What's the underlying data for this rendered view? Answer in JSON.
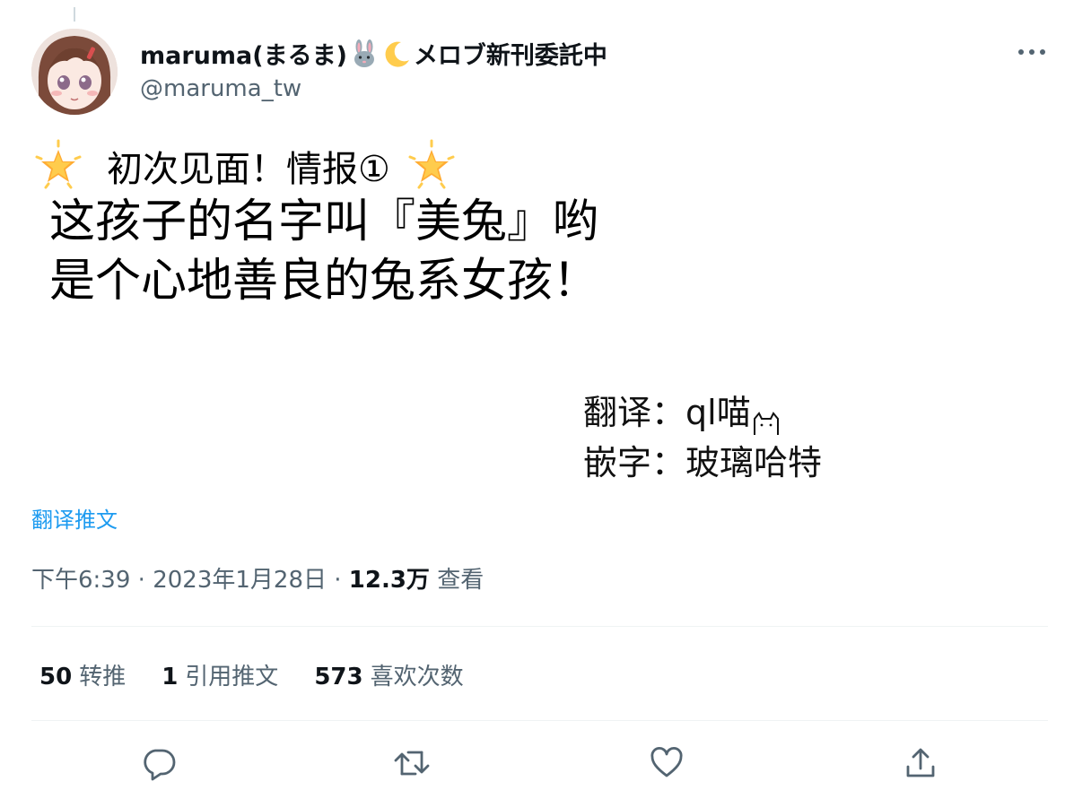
{
  "author": {
    "display_name": "maruma(まるま)",
    "display_name_suffix": "メロブ新刊委託中",
    "handle": "@maruma_tw",
    "name_icons": [
      "rabbit-icon",
      "crescent-moon-icon"
    ]
  },
  "tweet": {
    "line1": "初次见面！情报①",
    "line2": "这孩子的名字叫『美兔』哟",
    "line3": "是个心地善良的兔系女孩！",
    "credits": {
      "translate_label": "翻译：",
      "translate_name": "ql喵",
      "typeset_label": "嵌字：",
      "typeset_name": "玻璃哈特"
    }
  },
  "translate_link": "翻译推文",
  "meta": {
    "time": "下午6:39",
    "separator": "·",
    "date": "2023年1月28日",
    "views_count": "12.3万",
    "views_label": "查看"
  },
  "stats": {
    "retweets_count": "50",
    "retweets_label": "转推",
    "quotes_count": "1",
    "quotes_label": "引用推文",
    "likes_count": "573",
    "likes_label": "喜欢次数"
  },
  "icons": {
    "star": "glowing-star-icon",
    "more": "more-icon",
    "reply": "reply-icon",
    "retweet": "retweet-icon",
    "like": "heart-icon",
    "share": "share-icon"
  },
  "colors": {
    "link": "#1d9bf0",
    "secondary_text": "#536471",
    "primary_text": "#0f1419",
    "divider": "#eff3f4"
  }
}
